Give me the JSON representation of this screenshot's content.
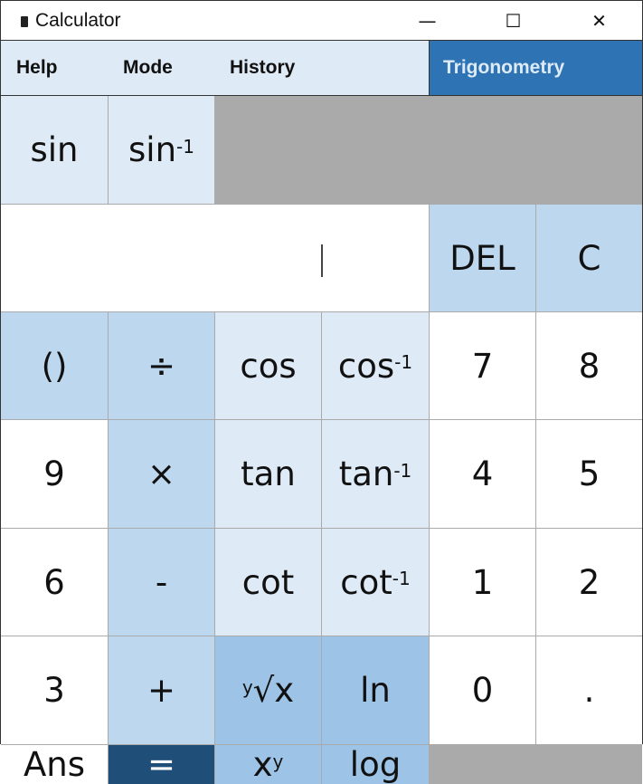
{
  "window": {
    "title": "Calculator",
    "minimize": "—",
    "maximize": "☐",
    "close": "✕",
    "icon": "calculator-icon"
  },
  "menu": {
    "items": [
      "Help",
      "Mode",
      "History"
    ],
    "active_tab": "Trigonometry"
  },
  "display": {
    "value": ""
  },
  "colors": {
    "menu_bg": "#deeaf6",
    "tab_active": "#2e74b5",
    "operator": "#bdd7ee",
    "trig": "#deeaf6",
    "function": "#9dc3e6",
    "equals": "#1f4e79"
  },
  "buttons": [
    {
      "label": "sin",
      "style": "t",
      "name": "sin"
    },
    {
      "label": "sin",
      "sup": "-1",
      "style": "t",
      "name": "asin"
    },
    {
      "label": "DEL",
      "style": "l",
      "name": "delete"
    },
    {
      "label": "C",
      "style": "l",
      "name": "clear"
    },
    {
      "label": "()",
      "style": "l",
      "name": "parentheses"
    },
    {
      "label": "÷",
      "style": "l",
      "name": "divide"
    },
    {
      "label": "cos",
      "style": "t",
      "name": "cos"
    },
    {
      "label": "cos",
      "sup": "-1",
      "style": "t",
      "name": "acos"
    },
    {
      "label": "7",
      "style": "w",
      "name": "digit-7"
    },
    {
      "label": "8",
      "style": "w",
      "name": "digit-8"
    },
    {
      "label": "9",
      "style": "w",
      "name": "digit-9"
    },
    {
      "label": "×",
      "style": "l",
      "name": "multiply"
    },
    {
      "label": "tan",
      "style": "t",
      "name": "tan"
    },
    {
      "label": "tan",
      "sup": "-1",
      "style": "t",
      "name": "atan"
    },
    {
      "label": "4",
      "style": "w",
      "name": "digit-4"
    },
    {
      "label": "5",
      "style": "w",
      "name": "digit-5"
    },
    {
      "label": "6",
      "style": "w",
      "name": "digit-6"
    },
    {
      "label": "-",
      "style": "l",
      "name": "subtract"
    },
    {
      "label": "cot",
      "style": "t",
      "name": "cot"
    },
    {
      "label": "cot",
      "sup": "-1",
      "style": "t",
      "name": "acot"
    },
    {
      "label": "1",
      "style": "w",
      "name": "digit-1"
    },
    {
      "label": "2",
      "style": "w",
      "name": "digit-2"
    },
    {
      "label": "3",
      "style": "w",
      "name": "digit-3"
    },
    {
      "label": "+",
      "style": "l",
      "name": "add"
    },
    {
      "label": "√x",
      "presup": "y",
      "style": "m",
      "name": "yth-root"
    },
    {
      "label": "ln",
      "style": "m",
      "name": "ln"
    },
    {
      "label": "0",
      "style": "w",
      "name": "digit-0"
    },
    {
      "label": ".",
      "style": "w",
      "name": "decimal"
    },
    {
      "label": "Ans",
      "style": "w",
      "name": "ans"
    },
    {
      "label": "=",
      "style": "d",
      "name": "equals"
    },
    {
      "label": "x",
      "sup": "y",
      "style": "m",
      "name": "power"
    },
    {
      "label": "log",
      "style": "m",
      "name": "log"
    }
  ]
}
